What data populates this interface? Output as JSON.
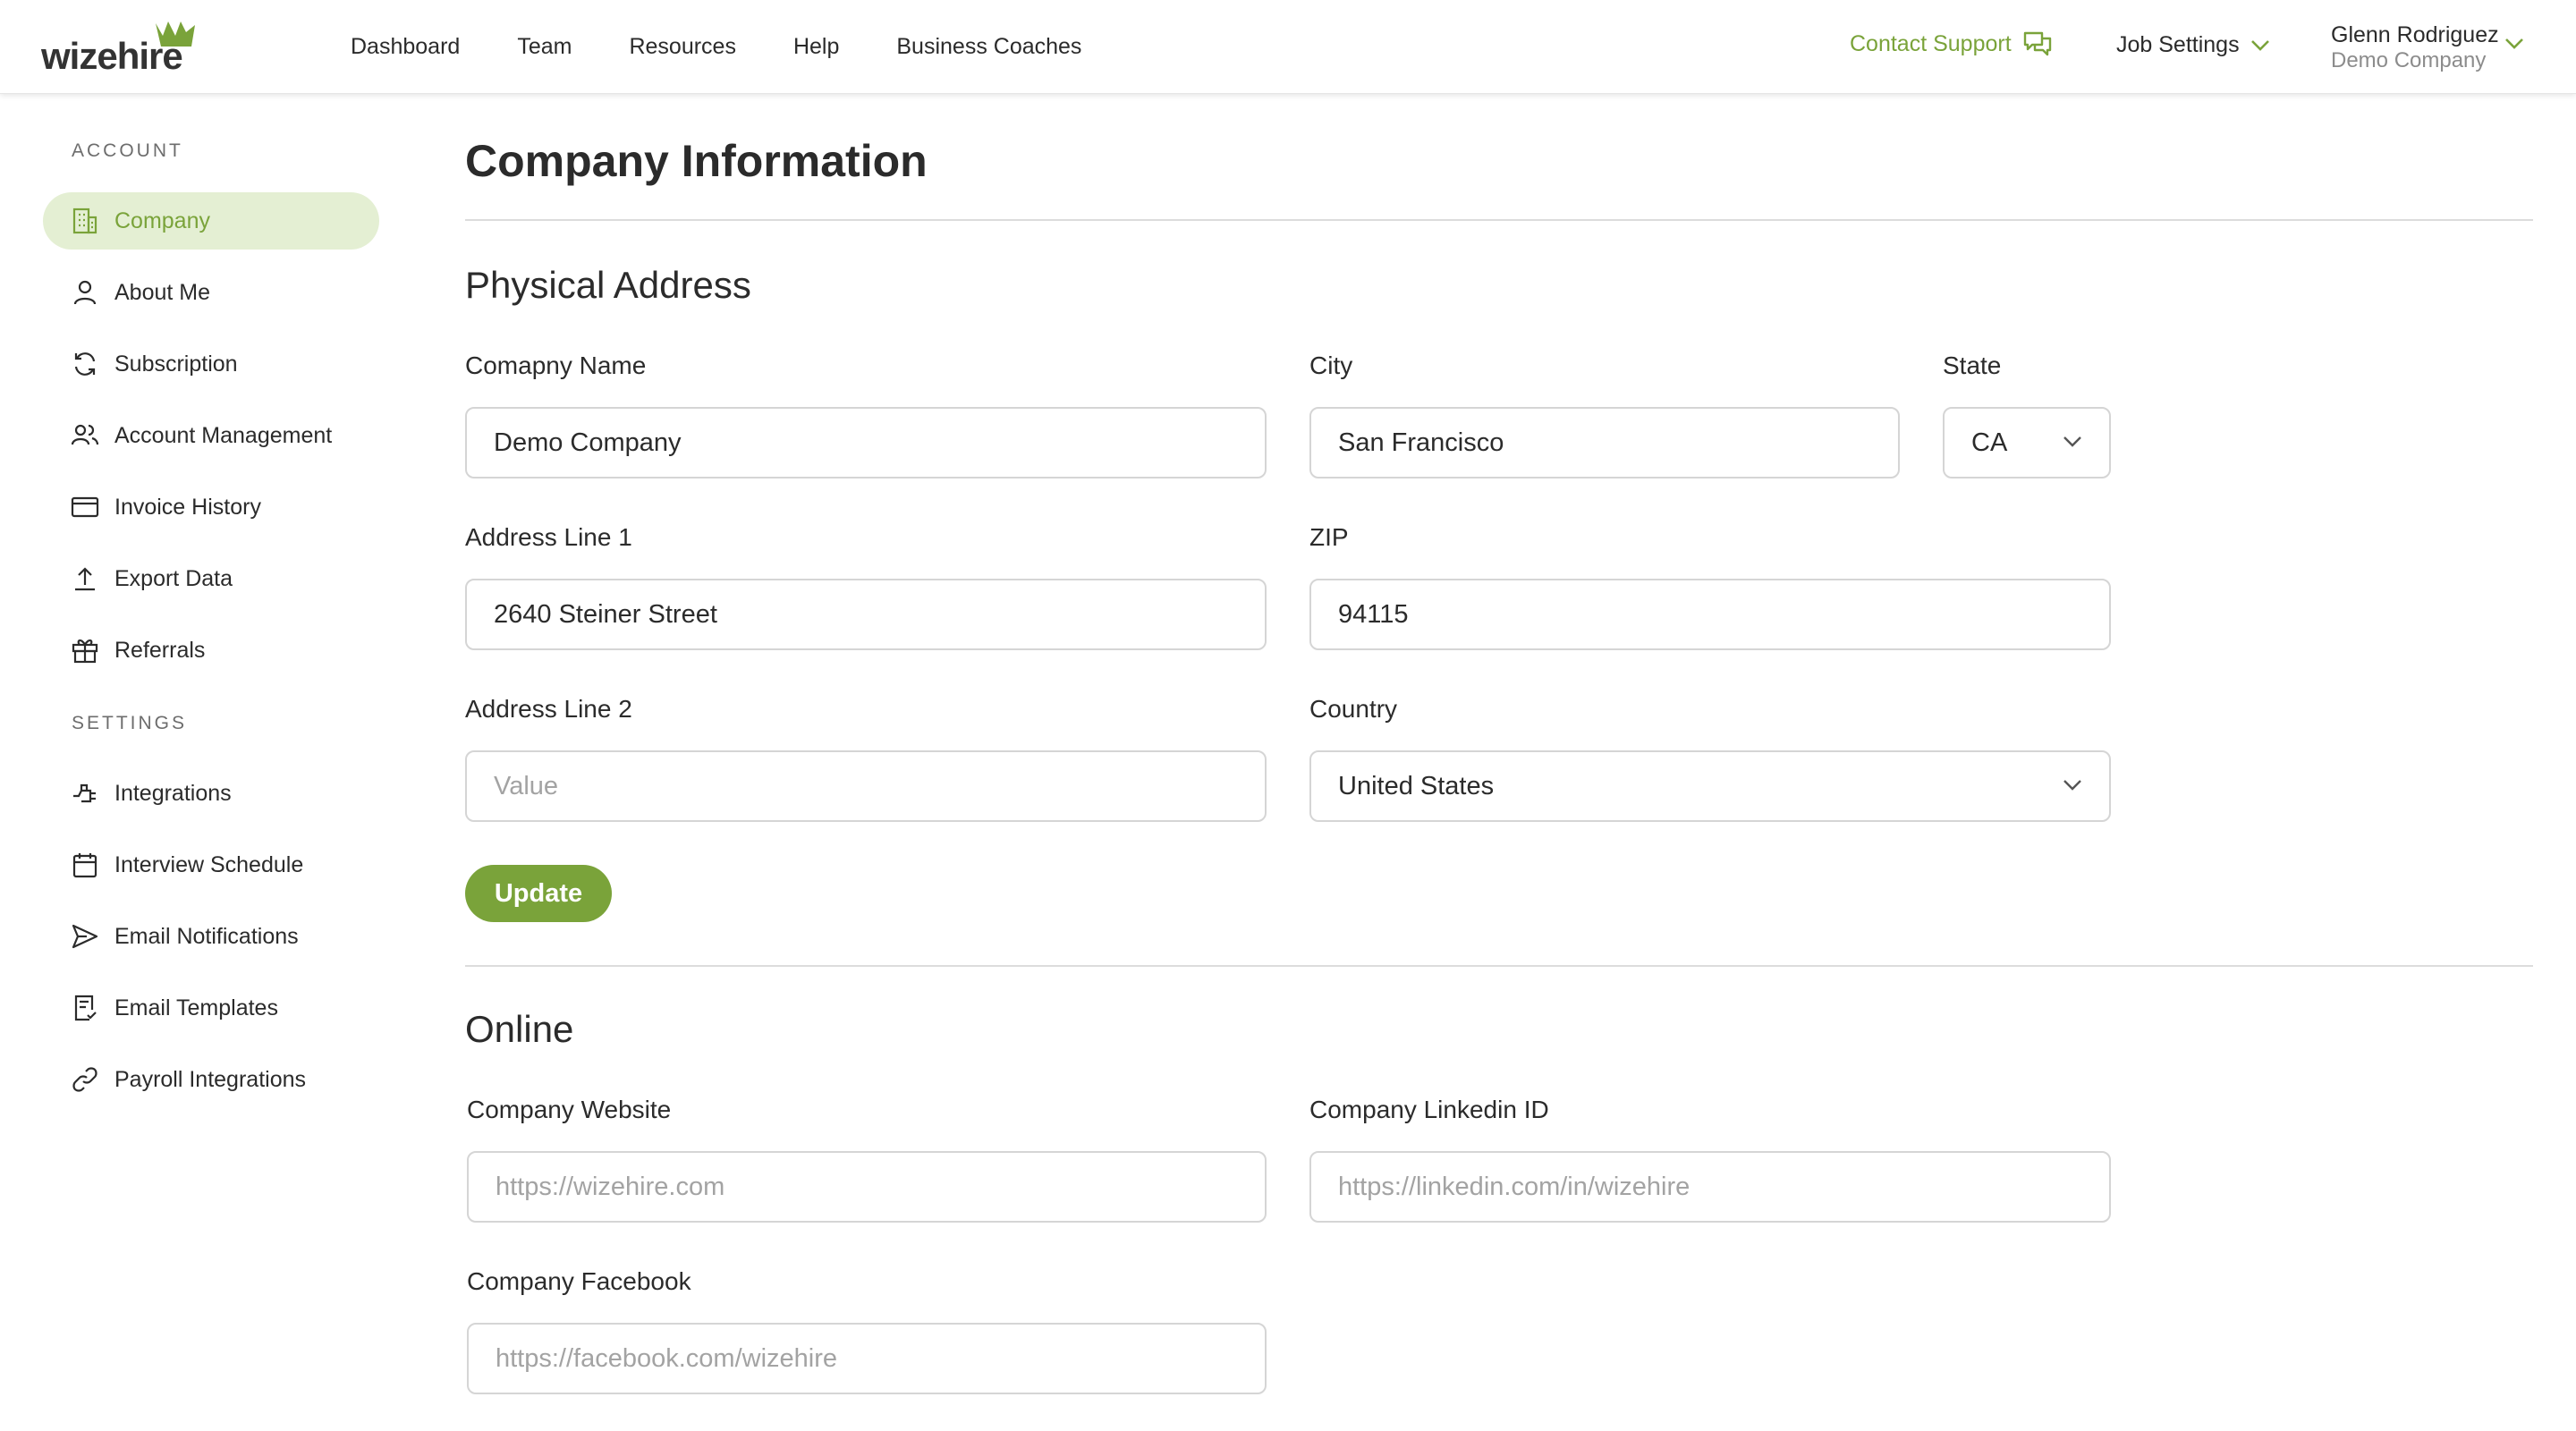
{
  "header": {
    "logo_text": "wizehire",
    "nav": [
      "Dashboard",
      "Team",
      "Resources",
      "Help",
      "Business Coaches"
    ],
    "contact_support": "Contact Support",
    "job_settings": "Job Settings",
    "user_name": "Glenn Rodriguez",
    "user_company": "Demo Company",
    "accent_color": "#7aa33a"
  },
  "sidebar": {
    "account_heading": "ACCOUNT",
    "settings_heading": "SETTINGS",
    "account_items": [
      {
        "label": "Company",
        "icon": "building-icon",
        "active": true
      },
      {
        "label": "About Me",
        "icon": "user-icon"
      },
      {
        "label": "Subscription",
        "icon": "refresh-icon"
      },
      {
        "label": "Account Management",
        "icon": "users-icon"
      },
      {
        "label": "Invoice History",
        "icon": "credit-card-icon"
      },
      {
        "label": "Export Data",
        "icon": "upload-icon"
      },
      {
        "label": "Referrals",
        "icon": "gift-icon"
      }
    ],
    "settings_items": [
      {
        "label": "Integrations",
        "icon": "plug-icon"
      },
      {
        "label": "Interview Schedule",
        "icon": "calendar-icon"
      },
      {
        "label": "Email Notifications",
        "icon": "send-icon"
      },
      {
        "label": "Email Templates",
        "icon": "document-check-icon"
      },
      {
        "label": "Payroll Integrations",
        "icon": "link-icon"
      }
    ]
  },
  "main": {
    "title": "Company Information",
    "physical": {
      "title": "Physical Address",
      "company_name_label": "Comapny Name",
      "company_name_value": "Demo Company",
      "city_label": "City",
      "city_value": "San Francisco",
      "state_label": "State",
      "state_value": "CA",
      "address1_label": "Address Line 1",
      "address1_value": "2640 Steiner Street",
      "zip_label": "ZIP",
      "zip_value": "94115",
      "address2_label": "Address Line 2",
      "address2_placeholder": "Value",
      "country_label": "Country",
      "country_value": "United States",
      "update_label": "Update"
    },
    "online": {
      "title": "Online",
      "website_label": "Company Website",
      "website_placeholder": "https://wizehire.com",
      "linkedin_label": "Company Linkedin ID",
      "linkedin_placeholder": "https://linkedin.com/in/wizehire",
      "facebook_label": "Company Facebook",
      "facebook_placeholder": "https://facebook.com/wizehire"
    }
  }
}
